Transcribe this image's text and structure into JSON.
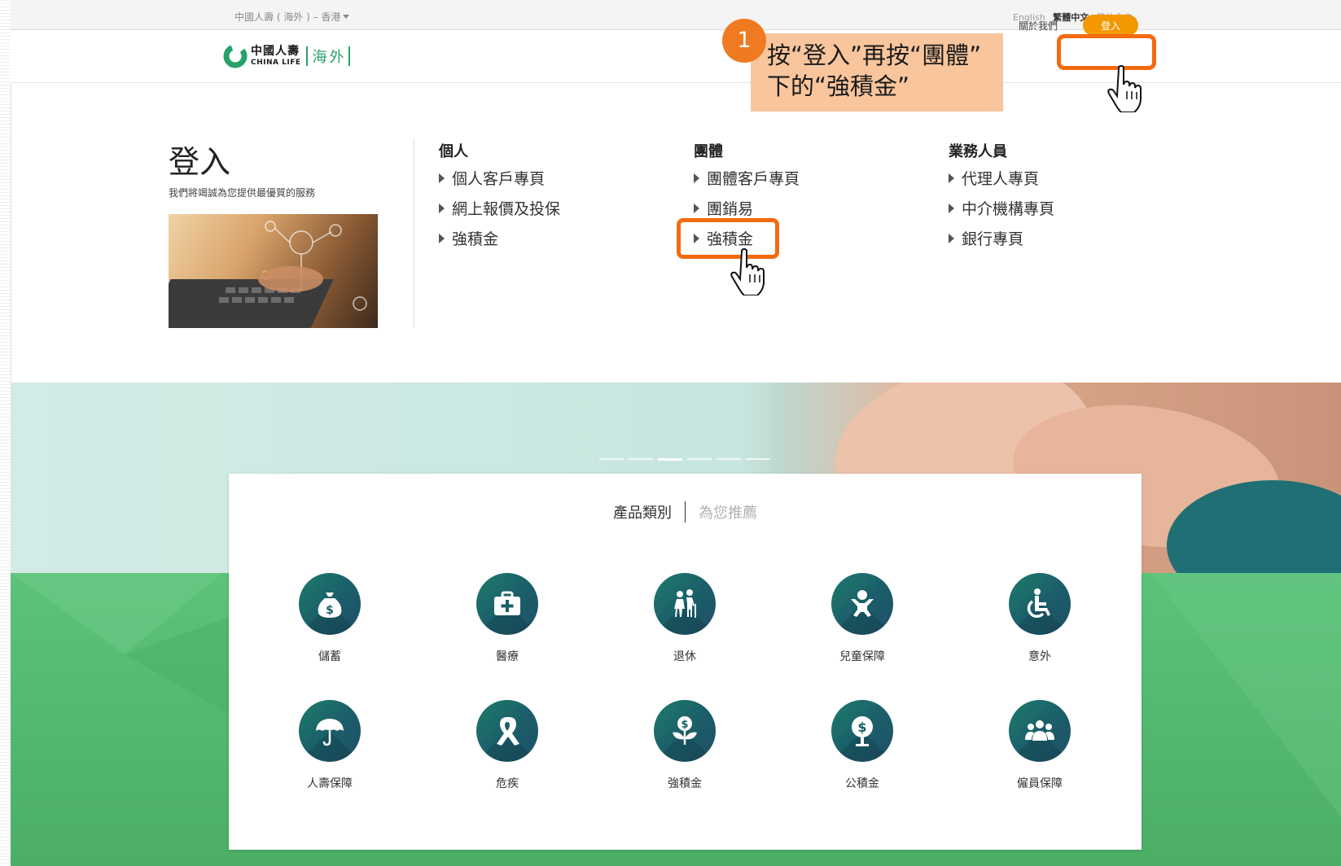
{
  "topbar": {
    "region": "中國人壽 ( 海外 ) – 香港",
    "languages": [
      {
        "label": "English",
        "active": false
      },
      {
        "label": "繁體中文",
        "active": true
      },
      {
        "label": "简体中文",
        "active": false
      }
    ]
  },
  "header": {
    "logo": {
      "cn": "中國人壽",
      "en": "CHINA LIFE",
      "overseas": "海外"
    },
    "about": "關於我們",
    "login": "登入"
  },
  "annotation": {
    "step": "1",
    "text": "按“登入”再按“團體”\n下的“強積金”"
  },
  "login_menu": {
    "title": "登入",
    "subtitle": "我們將竭誠為您提供最優質的服務",
    "columns": [
      {
        "heading": "個人",
        "items": [
          "個人客戶專頁",
          "網上報價及投保",
          "強積金"
        ]
      },
      {
        "heading": "團體",
        "items": [
          "團體客戶專頁",
          "團銷易",
          "強積金"
        ]
      },
      {
        "heading": "業務人員",
        "items": [
          "代理人專頁",
          "中介機構專頁",
          "銀行專頁"
        ]
      }
    ]
  },
  "carousel": {
    "slides": 6,
    "active_index": 2
  },
  "products": {
    "tabs": [
      {
        "label": "產品類別",
        "active": true
      },
      {
        "label": "為您推薦",
        "active": false
      }
    ],
    "categories": [
      {
        "label": "儲蓄",
        "icon": "money-bag-icon"
      },
      {
        "label": "醫療",
        "icon": "medical-kit-icon"
      },
      {
        "label": "退休",
        "icon": "elderly-couple-icon"
      },
      {
        "label": "兒童保障",
        "icon": "baby-icon"
      },
      {
        "label": "意外",
        "icon": "wheelchair-icon"
      },
      {
        "label": "人壽保障",
        "icon": "umbrella-icon"
      },
      {
        "label": "危疾",
        "icon": "ribbon-icon"
      },
      {
        "label": "強積金",
        "icon": "money-plant-icon"
      },
      {
        "label": "公積金",
        "icon": "money-tree-icon"
      },
      {
        "label": "僱員保障",
        "icon": "group-icon"
      }
    ]
  },
  "colors": {
    "brand_green": "#26a269",
    "login_orange": "#f39800",
    "highlight": "#f26b10",
    "callout_bg": "#f8c59c",
    "icon_teal": "#1b5f6a"
  }
}
